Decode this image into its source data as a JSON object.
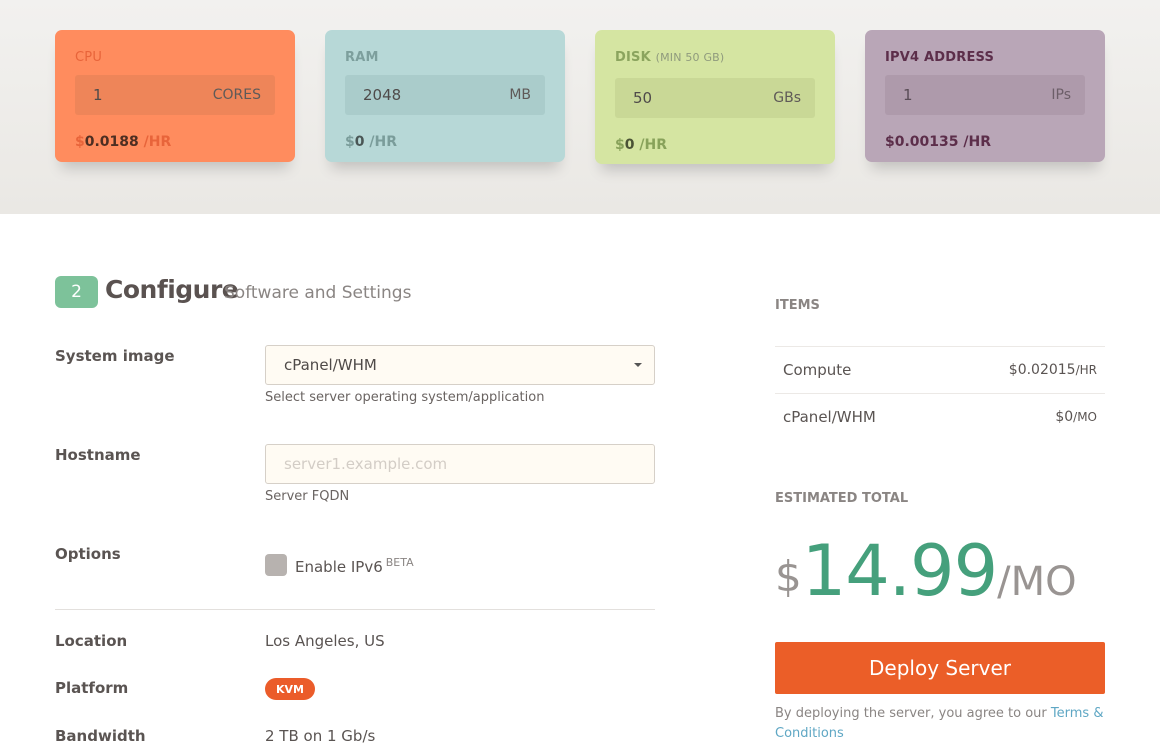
{
  "resources": {
    "cpu": {
      "title": "CPU",
      "value": "1",
      "unit": "CORES",
      "price_currency": "$",
      "price": "0.0188",
      "price_per": "/HR"
    },
    "ram": {
      "title": "RAM",
      "value": "2048",
      "unit": "MB",
      "price_currency": "$",
      "price": "0",
      "price_per": "/HR"
    },
    "disk": {
      "title": "DISK",
      "title_note": "(MIN 50 GB)",
      "value": "50",
      "unit": "GBs",
      "price_currency": "$",
      "price": "0",
      "price_per": "/HR"
    },
    "ipv4": {
      "title": "IPV4 ADDRESS",
      "value": "1",
      "unit": "IPs",
      "price_currency": "$",
      "price": "0.00135",
      "price_per": "/HR"
    }
  },
  "configure": {
    "step_number": "2",
    "title": "Configure",
    "subtitle": "Software and Settings",
    "system_image": {
      "label": "System image",
      "selected": "cPanel/WHM",
      "help": "Select server operating system/application"
    },
    "hostname": {
      "label": "Hostname",
      "value": "",
      "placeholder": "server1.example.com",
      "help": "Server FQDN"
    },
    "options": {
      "label": "Options",
      "ipv6_label": "Enable IPv6",
      "ipv6_badge": "BETA",
      "ipv6_checked": false
    },
    "location": {
      "label": "Location",
      "value": "Los Angeles, US"
    },
    "platform": {
      "label": "Platform",
      "value": "KVM"
    },
    "bandwidth": {
      "label": "Bandwidth",
      "value": "2 TB on 1 Gb/s"
    }
  },
  "summary": {
    "items_heading": "ITEMS",
    "items": [
      {
        "name": "Compute",
        "cost": "$0.02015",
        "per": "/HR"
      },
      {
        "name": "cPanel/WHM",
        "cost": "$0",
        "per": "/MO"
      }
    ],
    "total_heading": "ESTIMATED TOTAL",
    "total_currency": "$",
    "total_amount": "14.99",
    "total_per": "/MO",
    "deploy_label": "Deploy Server",
    "terms_text": "By deploying the server, you agree to our ",
    "terms_link": "Terms & Conditions"
  },
  "colors": {
    "cpu": "#ff8c5e",
    "ram": "#b7d8d7",
    "disk": "#d5e5a2",
    "ipv4": "#b9a6b7",
    "accent_green": "#45a07c",
    "deploy_orange": "#eb5e28"
  }
}
